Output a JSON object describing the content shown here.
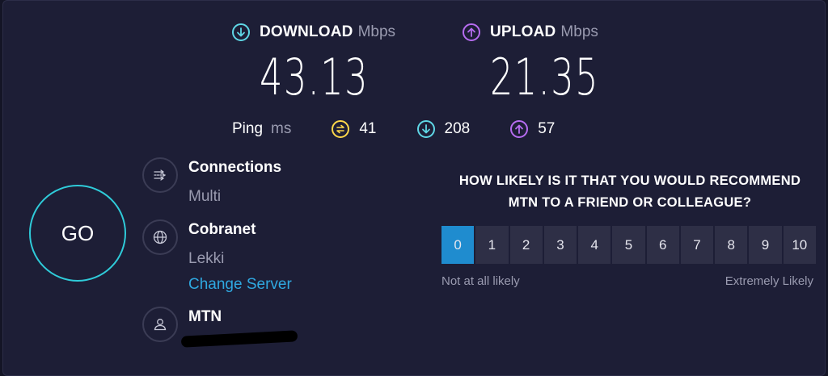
{
  "download": {
    "label": "DOWNLOAD",
    "unit": "Mbps",
    "value": "43.13",
    "icon": "download-arrow-icon",
    "color": "#5fd7e6"
  },
  "upload": {
    "label": "UPLOAD",
    "unit": "Mbps",
    "value": "21.35",
    "icon": "upload-arrow-icon",
    "color": "#b66cf0"
  },
  "ping": {
    "label": "Ping",
    "unit": "ms",
    "idle": {
      "value": "41",
      "icon": "ping-idle-icon",
      "color": "#ffd84a"
    },
    "download": {
      "value": "208",
      "icon": "download-arrow-icon",
      "color": "#5fd7e6"
    },
    "upload": {
      "value": "57",
      "icon": "upload-arrow-icon",
      "color": "#b66cf0"
    }
  },
  "go_button": {
    "label": "GO",
    "color": "#2fcbd9"
  },
  "connections": {
    "title": "Connections",
    "value": "Multi",
    "icon": "connections-icon"
  },
  "server": {
    "title": "Cobranet",
    "location": "Lekki",
    "change_label": "Change Server",
    "icon": "globe-icon"
  },
  "provider": {
    "title": "MTN",
    "icon": "user-icon"
  },
  "survey": {
    "question_line1": "HOW LIKELY IS IT THAT YOU WOULD RECOMMEND",
    "question_line2": "MTN TO A FRIEND OR COLLEAGUE?",
    "options": [
      "0",
      "1",
      "2",
      "3",
      "4",
      "5",
      "6",
      "7",
      "8",
      "9",
      "10"
    ],
    "selected": "0",
    "low_label": "Not at all likely",
    "high_label": "Extremely Likely",
    "accent": "#1f8ccf"
  }
}
